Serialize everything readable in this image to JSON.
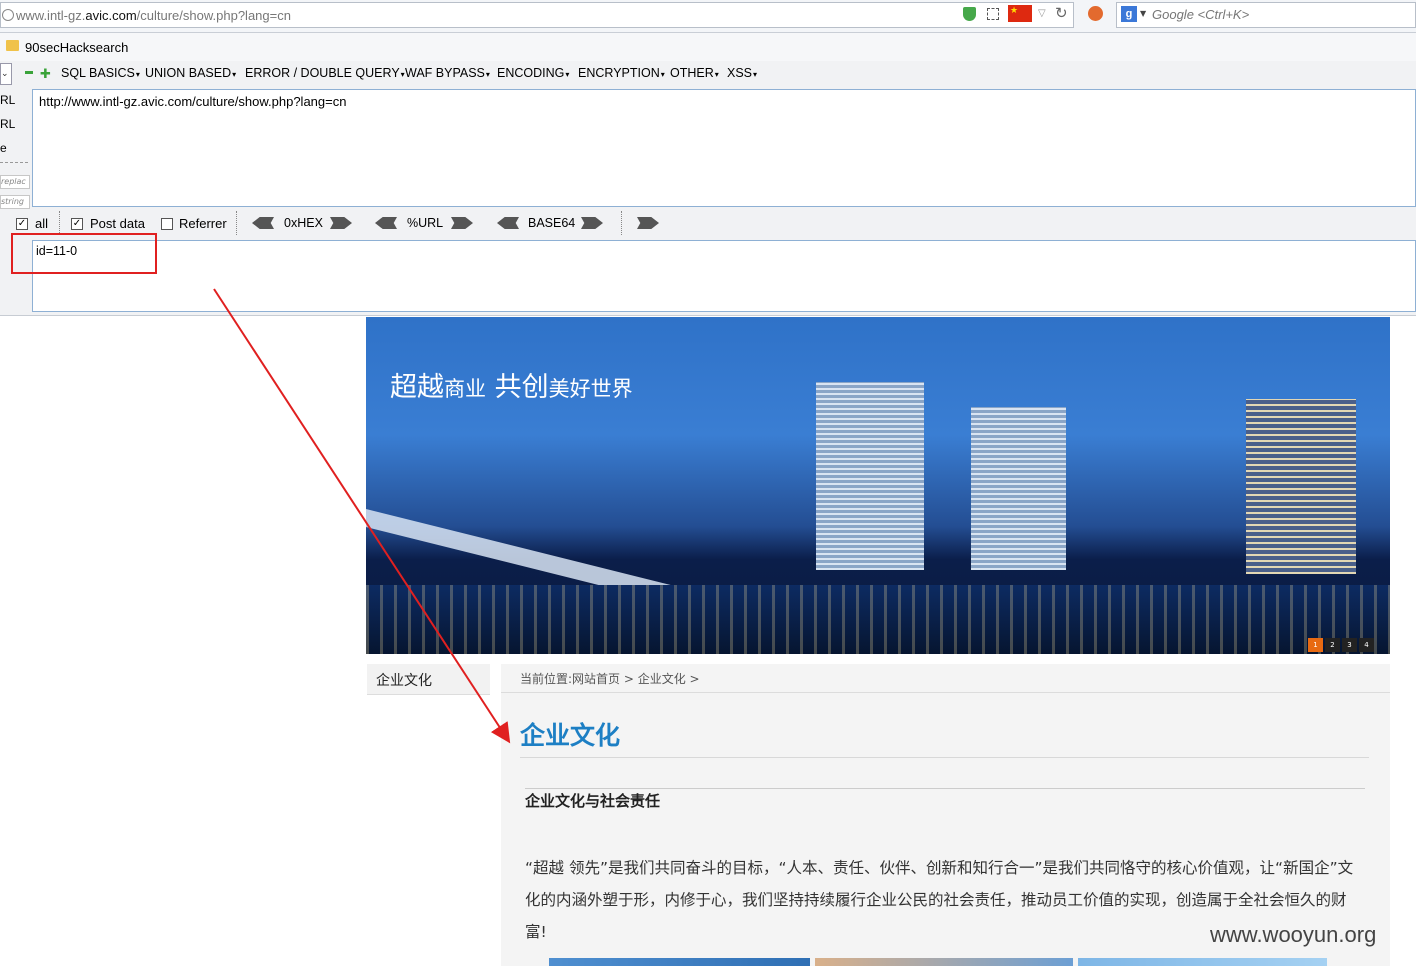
{
  "browser": {
    "url_prefix": "www.intl-gz.",
    "url_domain": "avic.com",
    "url_suffix": "/culture/show.php?lang=cn",
    "search_placeholder": "Google <Ctrl+K>",
    "search_engine_letter": "g"
  },
  "bookmarks": [
    {
      "label": "90secHacksearch"
    }
  ],
  "hackbar": {
    "menus": [
      "SQL BASICS",
      "UNION BASED",
      "ERROR / DOUBLE QUERY",
      "WAF BYPASS",
      "ENCODING",
      "ENCRYPTION",
      "OTHER",
      "XSS"
    ],
    "side_labels": [
      "RL",
      "RL",
      "e"
    ],
    "side_buttons": [
      "replac",
      "string"
    ],
    "url_value": "http://www.intl-gz.avic.com/culture/show.php?lang=cn",
    "checkboxes": [
      {
        "label": "all",
        "checked": true
      },
      {
        "label": "Post data",
        "checked": true
      },
      {
        "label": "Referrer",
        "checked": false
      }
    ],
    "encoders": [
      "0xHEX",
      "%URL",
      "BASE64"
    ],
    "post_value": "id=11-0"
  },
  "page": {
    "slogan_big1": "超越",
    "slogan_small1": "商业",
    "slogan_big2": "共创",
    "slogan_small2": "美好世界",
    "slider_dots": [
      "1",
      "2",
      "3",
      "4"
    ],
    "side_nav_item": "企业文化",
    "breadcrumb": "当前位置:网站首页 > 企业文化 >",
    "heading": "企业文化",
    "subheading": "企业文化与社会责任",
    "paragraph": "“超越 领先”是我们共同奋斗的目标，“人本、责任、伙伴、创新和知行合一”是我们共同恪守的核心价值观，让“新国企”文化的内涵外塑于形，内修于心，我们坚持持续履行企业公民的社会责任，推动员工价值的实现，创造属于全社会恒久的财富!"
  },
  "watermark": "www.wooyun.org",
  "colors": {
    "annotation_red": "#e02020",
    "heading_blue": "#1d7fc4",
    "active_dot": "#e86a12"
  }
}
